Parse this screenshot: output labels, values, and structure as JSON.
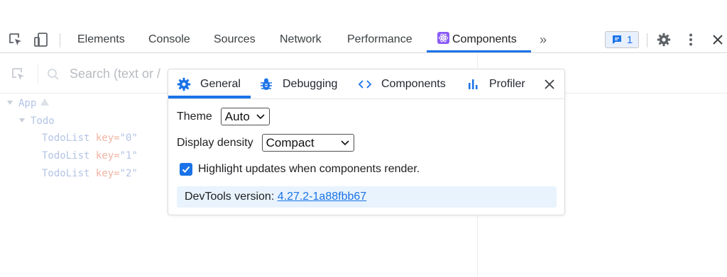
{
  "devtools": {
    "tabs": [
      {
        "label": "Elements"
      },
      {
        "label": "Console"
      },
      {
        "label": "Sources"
      },
      {
        "label": "Network"
      },
      {
        "label": "Performance"
      },
      {
        "label": "Components",
        "active": true
      }
    ],
    "more_tabs_glyph": "»",
    "issues_count": "1",
    "accent_color": "#1a73e8"
  },
  "search": {
    "placeholder": "Search (text or /"
  },
  "tree": {
    "app": "App",
    "todo": "Todo",
    "rows": [
      {
        "component": "TodoList",
        "key_name": "key",
        "key_value": "\"0\""
      },
      {
        "component": "TodoList",
        "key_name": "key",
        "key_value": "\"1\""
      },
      {
        "component": "TodoList",
        "key_name": "key",
        "key_value": "\"2\""
      }
    ]
  },
  "settings": {
    "tabs": [
      {
        "label": "General",
        "icon": "gear-icon",
        "active": true
      },
      {
        "label": "Debugging",
        "icon": "bug-icon"
      },
      {
        "label": "Components",
        "icon": "code-brackets-icon"
      },
      {
        "label": "Profiler",
        "icon": "bar-chart-icon"
      }
    ],
    "theme_label": "Theme",
    "theme_value": "Auto",
    "density_label": "Display density",
    "density_value": "Compact",
    "highlight_label": "Highlight updates when components render.",
    "highlight_checked": true,
    "version_label": "DevTools version: ",
    "version_value": "4.27.2-1a88fbb67"
  }
}
